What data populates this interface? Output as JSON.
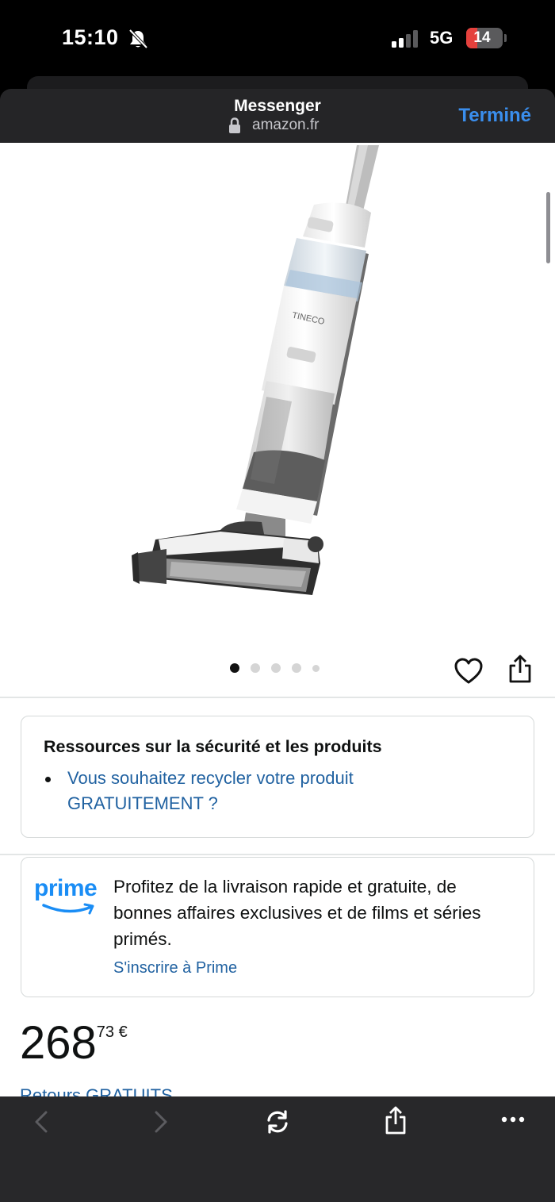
{
  "status_bar": {
    "time": "15:10",
    "network": "5G",
    "battery_level": "14"
  },
  "browser": {
    "title": "Messenger",
    "url": "amazon.fr",
    "done_label": "Terminé"
  },
  "product": {
    "image_brand_text": "TINECO",
    "carousel": {
      "total": 5,
      "active_index": 0
    }
  },
  "safety": {
    "title": "Ressources sur la sécurité et les produits",
    "link": "Vous souhaitez recycler votre produit GRATUITEMENT ?"
  },
  "prime": {
    "logo_text": "prime",
    "description": "Profitez de la livraison rapide et gratuite, de bonnes affaires exclusives et de films et séries primés.",
    "signup_link": "S'inscrire à Prime"
  },
  "price": {
    "whole": "268",
    "fraction": "73 €"
  },
  "returns": {
    "label": "Retours GRATUITS"
  },
  "toolbar": {
    "icons": [
      "back-icon",
      "forward-icon",
      "reload-icon",
      "share-icon",
      "more-icon"
    ]
  },
  "colors": {
    "link": "#2162a1",
    "prime_blue": "#1a8df5",
    "done_blue": "#3a8eed",
    "battery_low": "#e5413d"
  }
}
